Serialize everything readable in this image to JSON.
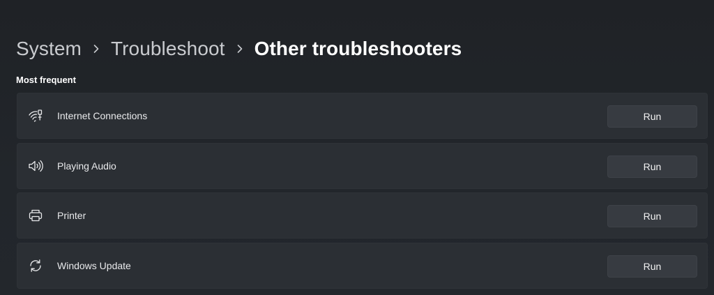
{
  "breadcrumb": {
    "items": [
      "System",
      "Troubleshoot"
    ],
    "current": "Other troubleshooters",
    "separator_icon": "chevron-right-icon"
  },
  "section": {
    "title": "Most frequent"
  },
  "troubleshooters": [
    {
      "label": "Internet Connections",
      "icon": "wifi-icon",
      "button": "Run"
    },
    {
      "label": "Playing Audio",
      "icon": "speaker-icon",
      "button": "Run"
    },
    {
      "label": "Printer",
      "icon": "printer-icon",
      "button": "Run"
    },
    {
      "label": "Windows Update",
      "icon": "sync-icon",
      "button": "Run"
    }
  ],
  "colors": {
    "background": "#202327",
    "card": "#2b2f34",
    "button": "#373b41",
    "text_primary": "#ffffff",
    "text_secondary": "#c9cbcf"
  }
}
